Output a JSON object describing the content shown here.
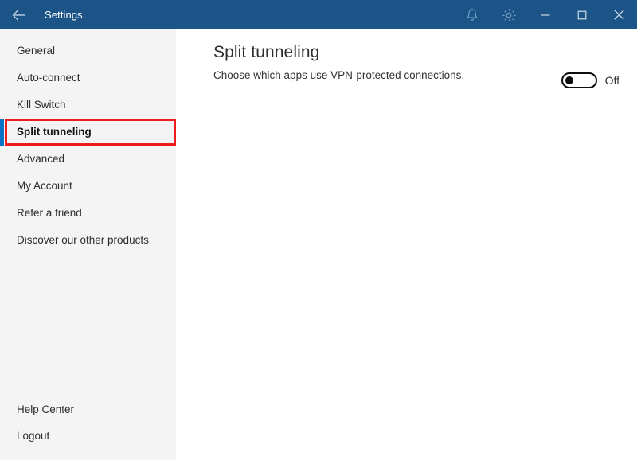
{
  "window": {
    "title": "Settings",
    "back_icon": "back-arrow-icon",
    "notifications_icon": "bell-icon",
    "settings_icon": "gear-icon",
    "minimize_icon": "minimize-icon",
    "maximize_icon": "maximize-icon",
    "close_icon": "close-icon",
    "titlebar_color": "#1c5488"
  },
  "sidebar": {
    "accent_color": "#0c72c5",
    "highlight_color": "#ee1c1c",
    "items": [
      {
        "label": "General",
        "selected": false
      },
      {
        "label": "Auto-connect",
        "selected": false
      },
      {
        "label": "Kill Switch",
        "selected": false
      },
      {
        "label": "Split tunneling",
        "selected": true
      },
      {
        "label": "Advanced",
        "selected": false
      },
      {
        "label": "My Account",
        "selected": false
      },
      {
        "label": "Refer a friend",
        "selected": false
      },
      {
        "label": "Discover our other products",
        "selected": false
      }
    ],
    "bottom_items": [
      {
        "label": "Help Center"
      },
      {
        "label": "Logout"
      }
    ]
  },
  "main": {
    "title": "Split tunneling",
    "subtitle": "Choose which apps use VPN-protected connections.",
    "toggle": {
      "state_label": "Off",
      "enabled": false
    }
  }
}
